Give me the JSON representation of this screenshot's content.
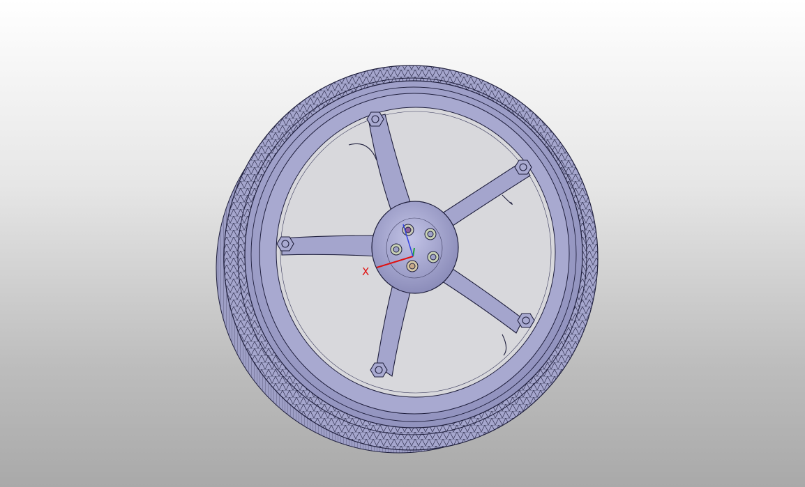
{
  "viewer": {
    "background_top": "#ffffff",
    "background_bottom": "#a9a9a9",
    "model": {
      "name": "wheel",
      "spoke_count": 5,
      "lug_bolt_count": 5,
      "rim_bolt_count": 5,
      "surface_color": "#a3a4cb",
      "edge_color": "#1e1e3c"
    },
    "triad": {
      "x_label": "X",
      "x_color": "#e01010",
      "y_color": "#20a040",
      "z_color": "#3040e0"
    }
  }
}
